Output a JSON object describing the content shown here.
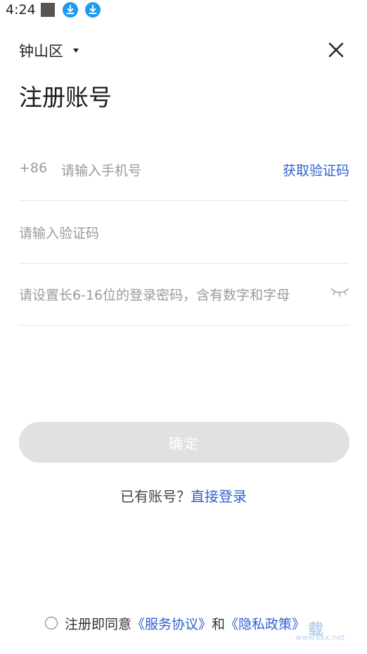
{
  "status_bar": {
    "time": "4:24"
  },
  "header": {
    "region": "钟山区",
    "title": "注册账号"
  },
  "form": {
    "country_code": "+86",
    "phone_placeholder": "请输入手机号",
    "get_code_label": "获取验证码",
    "code_placeholder": "请输入验证码",
    "password_placeholder": "请设置长6-16位的登录密码，含有数字和字母"
  },
  "actions": {
    "confirm_label": "确定",
    "have_account": "已有账号？",
    "login_link": "直接登录"
  },
  "agreement": {
    "prefix": "注册即同意",
    "service_link": "《服务协议》",
    "and": "和",
    "privacy_link": "《隐私政策》"
  },
  "watermark": {
    "big": "载",
    "site": "www.kkx.net"
  },
  "colors": {
    "accent": "#2f5fd0",
    "button_disabled": "#e1e1e1",
    "placeholder": "#9a9a9a",
    "download_icon": "#1e9bef"
  }
}
